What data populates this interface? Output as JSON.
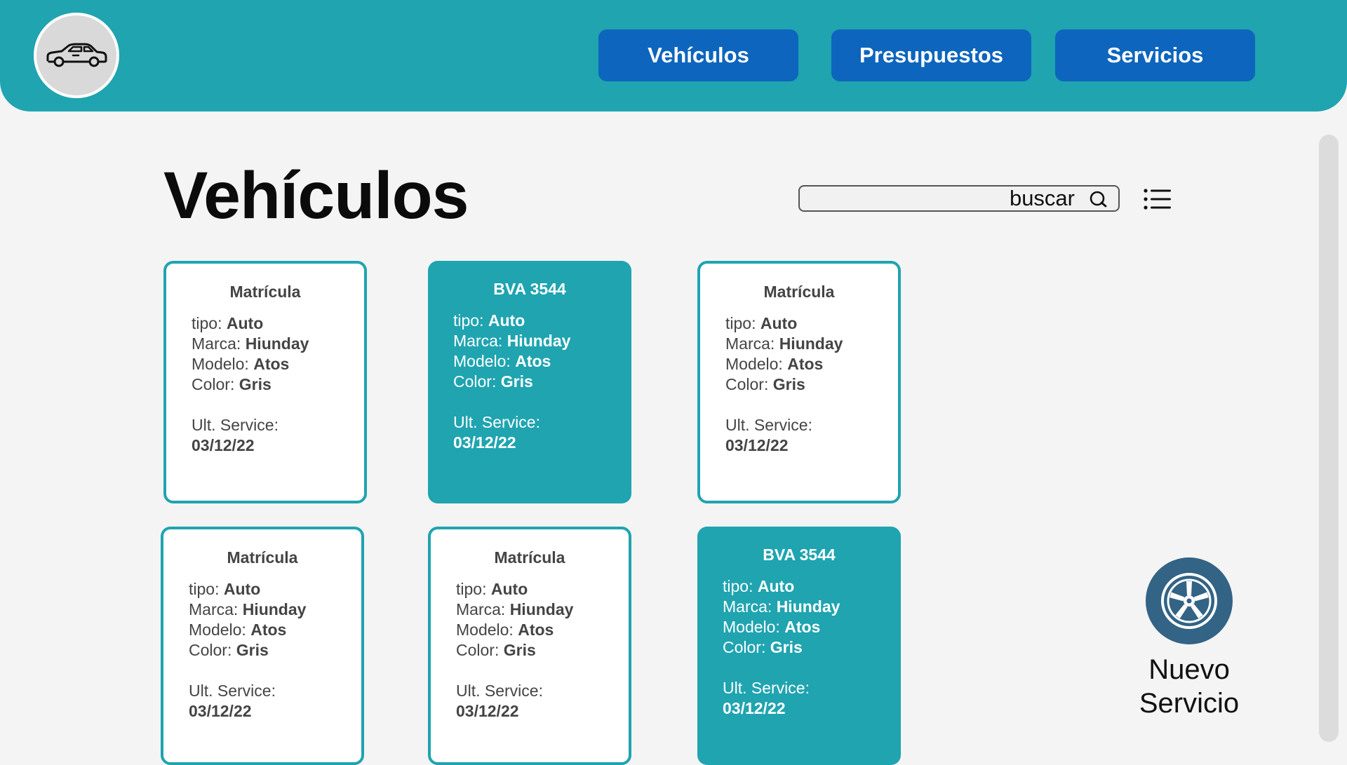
{
  "header": {
    "logo_icon": "car-icon",
    "nav": [
      {
        "label": "Vehículos"
      },
      {
        "label": "Presupuestos"
      },
      {
        "label": "Servicios"
      }
    ]
  },
  "main": {
    "title": "Vehículos",
    "search": {
      "placeholder": "buscar",
      "icon": "search-icon"
    },
    "view_toggle_icon": "list-icon"
  },
  "labels": {
    "tipo": "tipo: ",
    "marca": "Marca: ",
    "modelo": "Modelo: ",
    "color": "Color: ",
    "service": "Ult. Service:"
  },
  "vehicles": [
    {
      "title": "Matrícula",
      "tipo": "Auto",
      "marca": "Hiunday",
      "modelo": "Atos",
      "color": "Gris",
      "last_service": "03/12/22",
      "style": "outline"
    },
    {
      "title": "BVA 3544",
      "tipo": "Auto",
      "marca": "Hiunday",
      "modelo": "Atos",
      "color": "Gris",
      "last_service": "03/12/22",
      "style": "filled"
    },
    {
      "title": "Matrícula",
      "tipo": "Auto",
      "marca": "Hiunday",
      "modelo": "Atos",
      "color": "Gris",
      "last_service": "03/12/22",
      "style": "outline"
    },
    {
      "title": "Matrícula",
      "tipo": "Auto",
      "marca": "Hiunday",
      "modelo": "Atos",
      "color": "Gris",
      "last_service": "03/12/22",
      "style": "outline"
    },
    {
      "title": "Matrícula",
      "tipo": "Auto",
      "marca": "Hiunday",
      "modelo": "Atos",
      "color": "Gris",
      "last_service": "03/12/22",
      "style": "outline"
    },
    {
      "title": "BVA 3544",
      "tipo": "Auto",
      "marca": "Hiunday",
      "modelo": "Atos",
      "color": "Gris",
      "last_service": "03/12/22",
      "style": "filled"
    }
  ],
  "new_service": {
    "label_line1": "Nuevo",
    "label_line2": "Servicio",
    "icon": "wheel-icon"
  },
  "colors": {
    "header": "#1fa4b0",
    "nav_button": "#0d65bd",
    "card_accent": "#1fa4b0",
    "wheel": "#336385",
    "background": "#f4f4f4"
  }
}
